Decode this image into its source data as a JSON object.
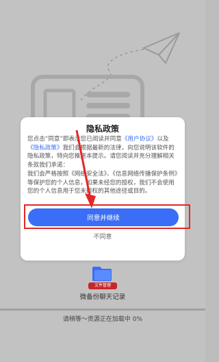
{
  "dialog": {
    "title": "隐私政策",
    "body_1": "您点击“同意”即表示您已阅读并同意",
    "user_agreement_link": "《用户协议》",
    "body_2": "以及",
    "privacy_policy_link": "《隐私政策》",
    "body_3": "我们会根据最新的法律，向您说明该软件的隐私政策，特向您推送本提示。请您阅读并充分理解相关条款我们承诺：",
    "body_4": "我们会严格按照《网络安全法》、《信息网络传播保护条例》等保护您的个人信息，如果未经您的授权，我们不会使用您的个人信息用于您未授权的其他途径或目的。",
    "agree_label": "同意并继续",
    "disagree_label": "不同意"
  },
  "bottom": {
    "badge": "文件管理",
    "label": "微备份聊天记录",
    "status": "请稍等～资源正在加载中 0%",
    "progress": 0
  },
  "colors": {
    "accent": "#3b6ef6",
    "highlight": "#e32626"
  },
  "icons": {
    "folder": "folder-icon",
    "plane": "paper-plane-icon"
  }
}
